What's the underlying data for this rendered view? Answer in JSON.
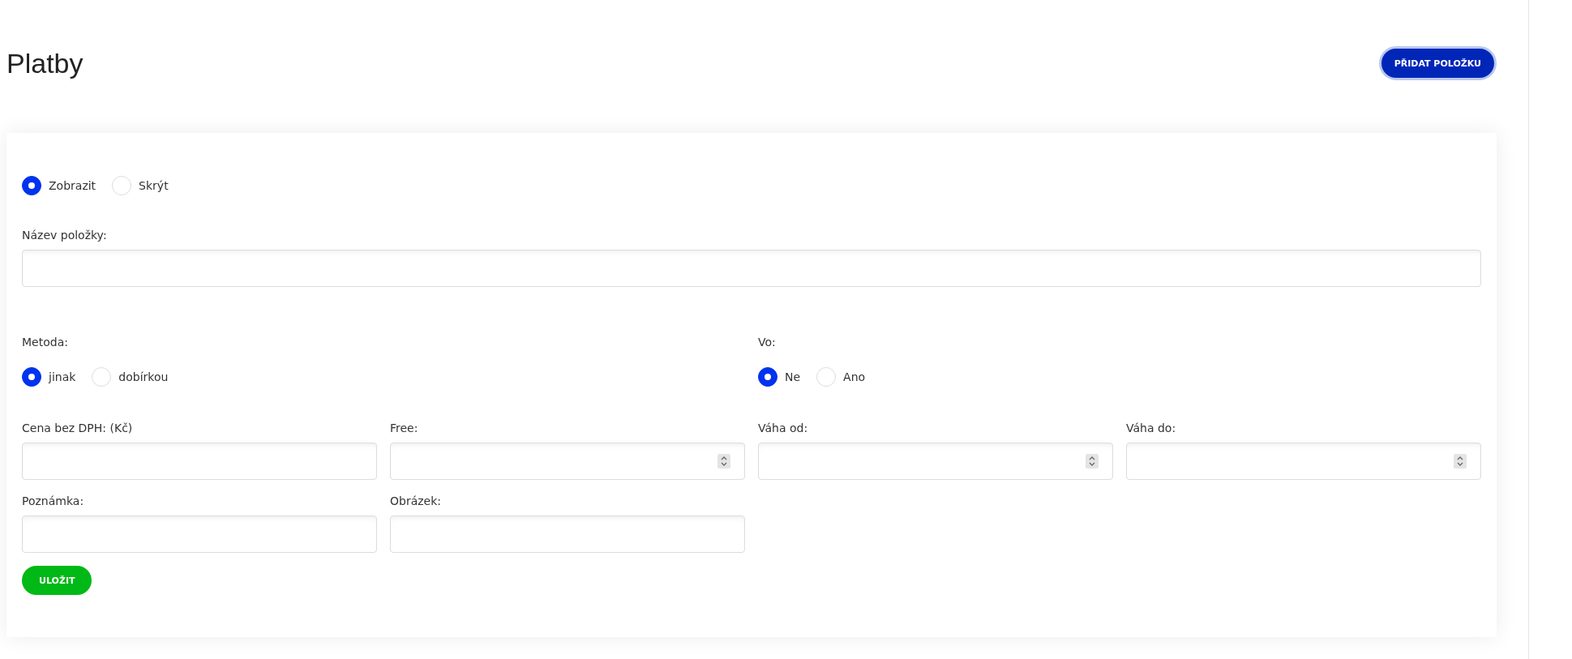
{
  "page_title": "Platby",
  "add_button": "PŘIDAT POLOŽKU",
  "visibility": {
    "options": [
      {
        "label": "Zobrazit",
        "selected": true
      },
      {
        "label": "Skrýt",
        "selected": false
      }
    ]
  },
  "name_field": {
    "label": "Název položky:"
  },
  "choice_groups": [
    {
      "label": "Metoda:",
      "options": [
        {
          "label": "jinak",
          "selected": true
        },
        {
          "label": "dobírkou",
          "selected": false
        }
      ]
    },
    {
      "label": "Vo:",
      "options": [
        {
          "label": "Ne",
          "selected": true
        },
        {
          "label": "Ano",
          "selected": false
        }
      ]
    }
  ],
  "fields": [
    {
      "label": "Cena bez DPH: (Kč)",
      "kind": "text"
    },
    {
      "label": "Free:",
      "kind": "number"
    },
    {
      "label": "Váha od:",
      "kind": "number"
    },
    {
      "label": "Váha do:",
      "kind": "number"
    },
    {
      "label": "Poznámka:",
      "kind": "text"
    },
    {
      "label": "Obrázek:",
      "kind": "text"
    }
  ],
  "save_button": "ULOŽIT"
}
